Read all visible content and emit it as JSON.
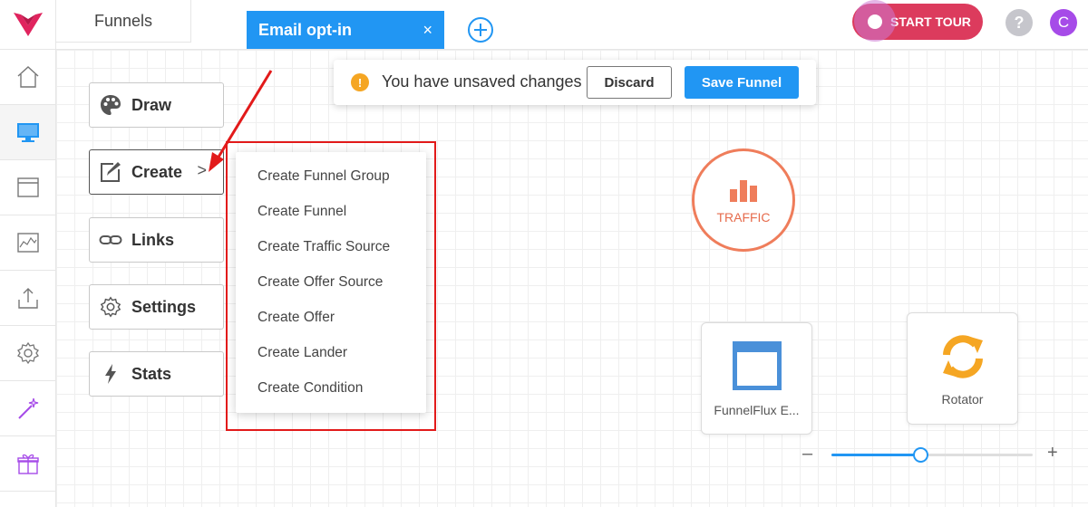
{
  "header": {
    "section_title": "Funnels",
    "tab_label": "Email opt-in",
    "tab_close": "×",
    "tour_button": "START TOUR",
    "help_glyph": "?",
    "avatar_initial": "C"
  },
  "rail": {
    "icons": [
      "home-icon",
      "monitor-icon",
      "browser-window-icon",
      "analytics-chart-icon",
      "upload-icon",
      "gear-icon",
      "magic-wand-icon",
      "gift-icon"
    ],
    "active": "monitor-icon"
  },
  "notice": {
    "message": "You have unsaved changes",
    "warn_glyph": "!",
    "discard_label": "Discard",
    "save_label": "Save Funnel"
  },
  "side_menu": {
    "draw": "Draw",
    "create": "Create",
    "create_chevron": ">",
    "links": "Links",
    "settings": "Settings",
    "stats": "Stats"
  },
  "create_menu": {
    "items": [
      "Create Funnel Group",
      "Create Funnel",
      "Create Traffic Source",
      "Create Offer Source",
      "Create Offer",
      "Create Lander",
      "Create Condition"
    ]
  },
  "nodes": {
    "traffic_label": "TRAFFIC",
    "lander_label": "FunnelFlux E...",
    "rotator_label": "Rotator"
  },
  "zoom": {
    "minus": "–",
    "plus": "+",
    "level": 0.44
  },
  "colors": {
    "accent_blue": "#2196f3",
    "tour_red": "#dc3b5d",
    "traffic_orange": "#ef7d5b",
    "rotator_orange": "#f5a623",
    "annotation_red": "#e21a1a",
    "brand_red": "#e0245e"
  }
}
